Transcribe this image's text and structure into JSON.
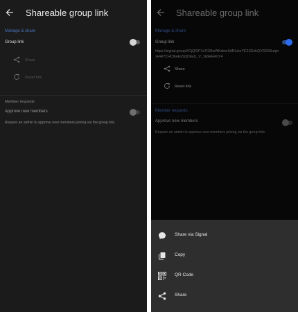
{
  "left": {
    "title": "Shareable group link",
    "manage_section": "Manage & share",
    "group_link_label": "Group link",
    "share_label": "Share",
    "reset_label": "Reset link",
    "requests_section": "Member requests",
    "approve_label": "Approve new members",
    "approve_desc": "Require an admin to approve new members joining via the group link."
  },
  "right": {
    "title": "Shareable group link",
    "manage_section": "Manage & share",
    "group_link_label": "Group link",
    "link_url": "https://signal.group/#CjQKIF7a7G9hxWKdmcSdRLdcrYE2SDzhQVSDS5uqmxHHt7CHCIkeEsSQDGdL_V_1ktHEHmY4",
    "share_label": "Share",
    "reset_label": "Reset link",
    "requests_section": "Member requests",
    "approve_label": "Approve new members",
    "approve_desc": "Require an admin to approve new members joining via the group link."
  },
  "sheet": {
    "items": [
      {
        "label": "Share via Signal",
        "icon": "chat-bubble-icon"
      },
      {
        "label": "Copy",
        "icon": "copy-icon"
      },
      {
        "label": "QR Code",
        "icon": "qr-code-icon"
      },
      {
        "label": "Share",
        "icon": "share-icon"
      }
    ]
  },
  "toggles": {
    "left_group_link_on": false,
    "left_approve_on": false,
    "right_group_link_on": true,
    "right_approve_on": false
  },
  "colors": {
    "accent": "#4b73bd",
    "toggle_on": "#2c6bed",
    "background": "#1b1b1b",
    "sheet": "#2e2e2e"
  }
}
